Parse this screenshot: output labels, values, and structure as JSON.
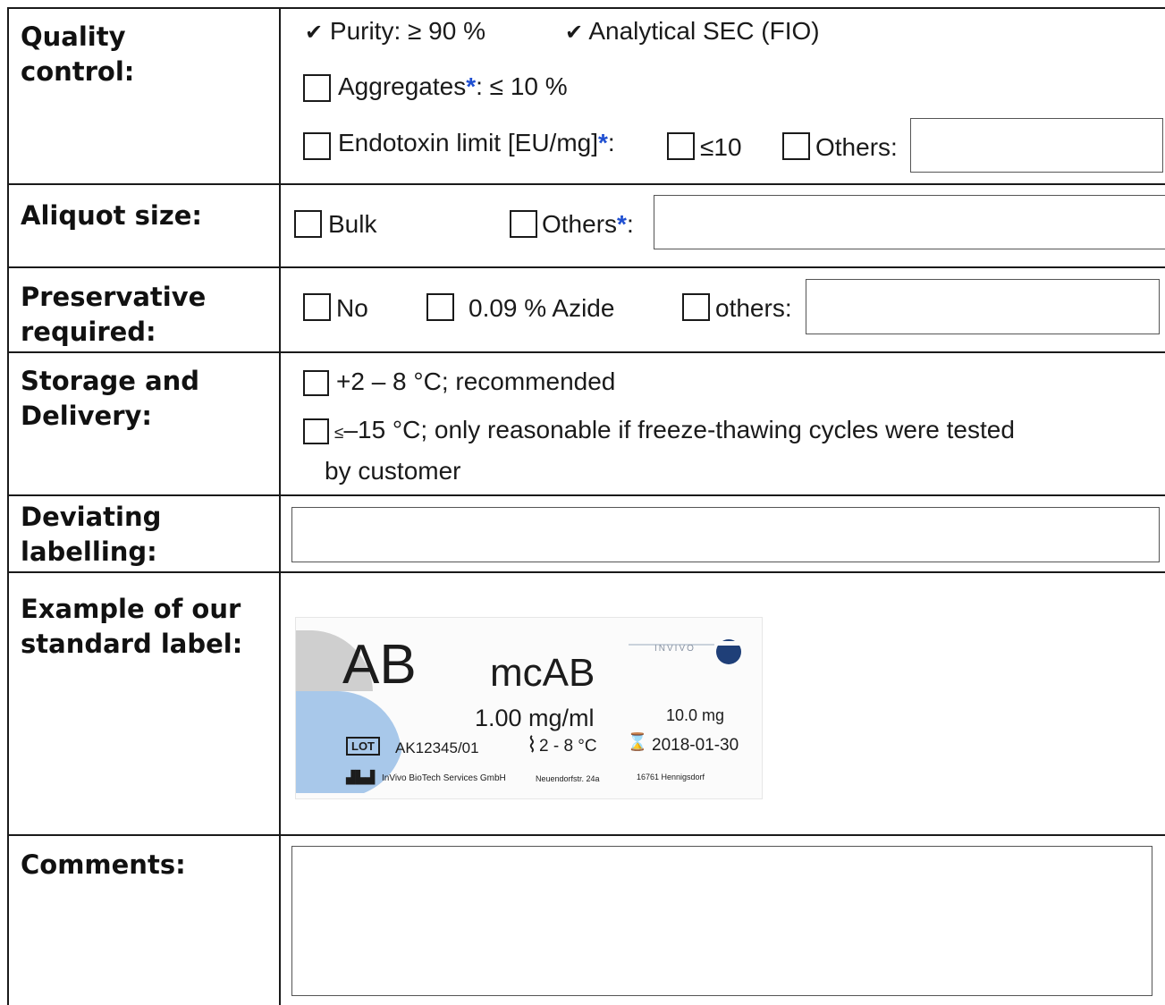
{
  "rows": {
    "quality": {
      "label_line1": "Quality",
      "label_line2": "control:",
      "purity_check": "✔",
      "purity_text": "Purity:  ≥ 90 %",
      "sec_check": "✔",
      "sec_text": "Analytical SEC (FIO)",
      "aggregates_text": "Aggregates",
      "aggregates_star": "*",
      "aggregates_value": ": ≤ 10 %",
      "endotoxin_text": "Endotoxin limit [EU/mg]",
      "endotoxin_star": "*",
      "endotoxin_colon": ":",
      "le10_text": "≤10",
      "others_text": "Others:",
      "others_value": ""
    },
    "aliquot": {
      "label": "Aliquot size:",
      "bulk_text": "Bulk",
      "others_text": "Others",
      "others_star": "*",
      "others_colon": ":",
      "others_value": ""
    },
    "preservative": {
      "label_line1": "Preservative",
      "label_line2": "required:",
      "no_text": "No",
      "azide_text": "0.09 % Azide",
      "others_text": "others:",
      "others_value": ""
    },
    "storage": {
      "label_line1": "Storage and",
      "label_line2": "Delivery:",
      "opt1_text": "+2 – 8 °C; recommended",
      "opt2_prefix": "≤",
      "opt2_text": "–15 °C;  only reasonable if freeze-thawing cycles were tested",
      "opt2_text_line2": "by customer"
    },
    "labelling": {
      "label_line1": "Deviating",
      "label_line2": "labelling:",
      "value": ""
    },
    "example": {
      "label_line1": "Example of our",
      "label_line2": "standard label:",
      "sample": {
        "code": "AB",
        "name": "mcAB",
        "brand": "INVIVO",
        "concentration": "1.00 mg/ml",
        "amount": "10.0 mg",
        "lot_tag": "LOT",
        "lot": "AK12345/01",
        "temperature": "2 - 8 °C",
        "expiry": "2018-01-30",
        "manufacturer": "InVivo BioTech Services GmbH",
        "street": "Neuendorfstr. 24a",
        "city": "16761 Hennigsdorf",
        "colors": {
          "grey": "#cfcfcf",
          "blue": "#a8c8ea",
          "navy": "#1f3f78"
        }
      }
    },
    "comments": {
      "label": "Comments:",
      "value": ""
    }
  },
  "colors": {
    "asterisk": "#1f4fd1",
    "border": "#1a1a1a"
  }
}
